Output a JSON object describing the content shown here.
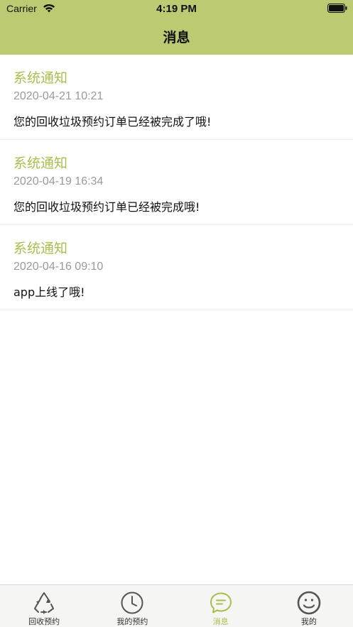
{
  "status_bar": {
    "carrier": "Carrier",
    "time": "4:19 PM"
  },
  "nav": {
    "title": "消息"
  },
  "messages": [
    {
      "title": "系统通知",
      "time": "2020-04-21 10:21",
      "body": "您的回收垃圾预约订单已经被完成了哦!"
    },
    {
      "title": "系统通知",
      "time": "2020-04-19 16:34",
      "body": "您的回收垃圾预约订单已经被完成哦!"
    },
    {
      "title": "系统通知",
      "time": "2020-04-16 09:10",
      "body": "app上线了哦!"
    }
  ],
  "tabs": [
    {
      "label": "回收预约",
      "icon": "recycle-icon",
      "active": false
    },
    {
      "label": "我的预约",
      "icon": "clock-icon",
      "active": false
    },
    {
      "label": "消息",
      "icon": "chat-bubble-icon",
      "active": true
    },
    {
      "label": "我的",
      "icon": "smiley-face-icon",
      "active": false
    }
  ],
  "colors": {
    "header_bg": "#bccb72",
    "accent": "#a9bd4c",
    "tab_bar_bg": "#f5f5f3"
  }
}
